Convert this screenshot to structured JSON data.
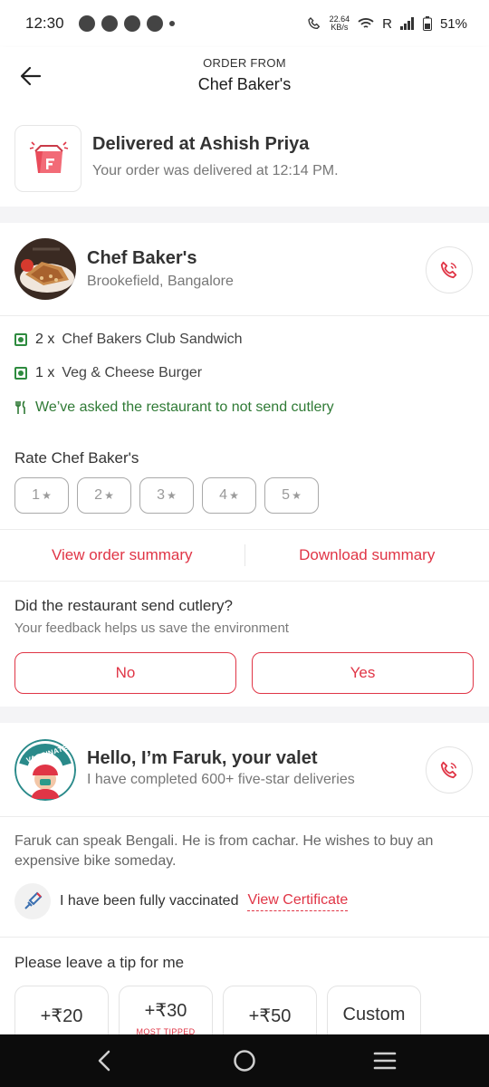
{
  "status_bar": {
    "time": "12:30",
    "network_speed": "22.64",
    "network_unit": "KB/s",
    "carrier": "R",
    "battery": "51%"
  },
  "header": {
    "subtitle": "ORDER FROM",
    "title": "Chef Baker's"
  },
  "delivery": {
    "title": "Delivered at Ashish Priya",
    "subtitle": "Your order was delivered at 12:14 PM."
  },
  "restaurant": {
    "name": "Chef Baker's",
    "location": "Brookefield, Bangalore"
  },
  "items": [
    {
      "qty": "2 x",
      "name": "Chef Bakers Club Sandwich"
    },
    {
      "qty": "1 x",
      "name": "Veg & Cheese Burger"
    }
  ],
  "cutlery_note": "We’ve asked the restaurant to not send cutlery",
  "rating": {
    "label": "Rate Chef Baker's",
    "options": [
      "1",
      "2",
      "3",
      "4",
      "5"
    ]
  },
  "links": {
    "view_summary": "View order summary",
    "download_summary": "Download summary"
  },
  "cutlery_question": {
    "title": "Did the restaurant send cutlery?",
    "subtitle": "Your feedback helps us save the environment",
    "no": "No",
    "yes": "Yes"
  },
  "valet": {
    "badge": "VACCINATED",
    "title": "Hello, I’m Faruk, your valet",
    "subtitle": "I have completed 600+ five-star deliveries",
    "description": "Faruk can speak Bengali. He is from cachar. He wishes to buy an expensive bike someday.",
    "vaccinated_text": "I have been fully vaccinated",
    "certificate_link": "View Certificate"
  },
  "tip": {
    "label": "Please leave a tip for me",
    "options": [
      "+₹20",
      "+₹30",
      "+₹50",
      "Custom"
    ],
    "most_tipped": "MOST TIPPED"
  },
  "colors": {
    "accent": "#e03546",
    "veg_green": "#2e8b3f",
    "note_green": "#2f7a35"
  }
}
